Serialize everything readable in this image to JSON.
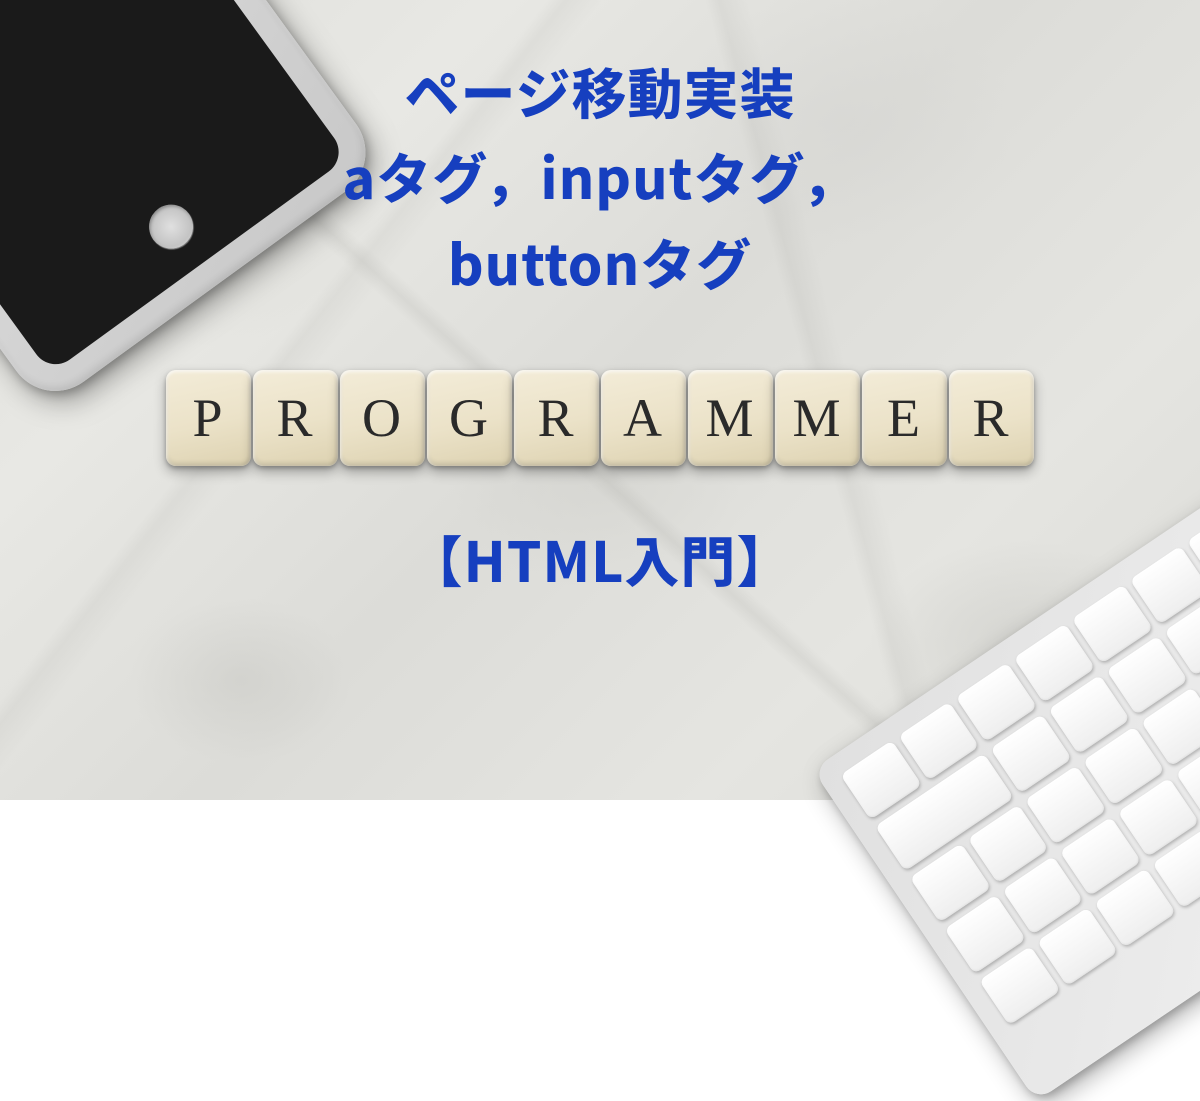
{
  "title": {
    "line1": "ページ移動実装",
    "line2": "aタグ，inputタグ，",
    "line3": "buttonタグ"
  },
  "tiles": {
    "letters": [
      "P",
      "R",
      "O",
      "G",
      "R",
      "A",
      "M",
      "M",
      "E",
      "R"
    ]
  },
  "subtitle": "【HTML入門】",
  "colors": {
    "text": "#163fbf",
    "tile_bg": "#ece3c9",
    "tile_letter": "#2a2a2a"
  }
}
